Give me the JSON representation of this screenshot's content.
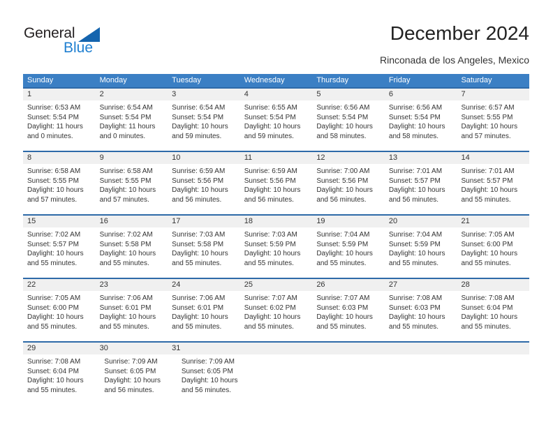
{
  "brand": {
    "name_part1": "General",
    "name_part2": "Blue",
    "triangle_color": "#1464ae",
    "blue_color": "#1f7fd0"
  },
  "header": {
    "title": "December 2024",
    "subtitle": "Rinconada de los Angeles, Mexico"
  },
  "theme": {
    "header_blue": "#3b7fc4",
    "row_rule_blue": "#2e6aa8",
    "daynum_band": "#f0f0f0",
    "text": "#333333"
  },
  "weekdays": [
    "Sunday",
    "Monday",
    "Tuesday",
    "Wednesday",
    "Thursday",
    "Friday",
    "Saturday"
  ],
  "weeks": [
    {
      "days": [
        {
          "num": "1",
          "sunrise": "Sunrise: 6:53 AM",
          "sunset": "Sunset: 5:54 PM",
          "daylight1": "Daylight: 11 hours",
          "daylight2": "and 0 minutes."
        },
        {
          "num": "2",
          "sunrise": "Sunrise: 6:54 AM",
          "sunset": "Sunset: 5:54 PM",
          "daylight1": "Daylight: 11 hours",
          "daylight2": "and 0 minutes."
        },
        {
          "num": "3",
          "sunrise": "Sunrise: 6:54 AM",
          "sunset": "Sunset: 5:54 PM",
          "daylight1": "Daylight: 10 hours",
          "daylight2": "and 59 minutes."
        },
        {
          "num": "4",
          "sunrise": "Sunrise: 6:55 AM",
          "sunset": "Sunset: 5:54 PM",
          "daylight1": "Daylight: 10 hours",
          "daylight2": "and 59 minutes."
        },
        {
          "num": "5",
          "sunrise": "Sunrise: 6:56 AM",
          "sunset": "Sunset: 5:54 PM",
          "daylight1": "Daylight: 10 hours",
          "daylight2": "and 58 minutes."
        },
        {
          "num": "6",
          "sunrise": "Sunrise: 6:56 AM",
          "sunset": "Sunset: 5:54 PM",
          "daylight1": "Daylight: 10 hours",
          "daylight2": "and 58 minutes."
        },
        {
          "num": "7",
          "sunrise": "Sunrise: 6:57 AM",
          "sunset": "Sunset: 5:55 PM",
          "daylight1": "Daylight: 10 hours",
          "daylight2": "and 57 minutes."
        }
      ]
    },
    {
      "days": [
        {
          "num": "8",
          "sunrise": "Sunrise: 6:58 AM",
          "sunset": "Sunset: 5:55 PM",
          "daylight1": "Daylight: 10 hours",
          "daylight2": "and 57 minutes."
        },
        {
          "num": "9",
          "sunrise": "Sunrise: 6:58 AM",
          "sunset": "Sunset: 5:55 PM",
          "daylight1": "Daylight: 10 hours",
          "daylight2": "and 57 minutes."
        },
        {
          "num": "10",
          "sunrise": "Sunrise: 6:59 AM",
          "sunset": "Sunset: 5:56 PM",
          "daylight1": "Daylight: 10 hours",
          "daylight2": "and 56 minutes."
        },
        {
          "num": "11",
          "sunrise": "Sunrise: 6:59 AM",
          "sunset": "Sunset: 5:56 PM",
          "daylight1": "Daylight: 10 hours",
          "daylight2": "and 56 minutes."
        },
        {
          "num": "12",
          "sunrise": "Sunrise: 7:00 AM",
          "sunset": "Sunset: 5:56 PM",
          "daylight1": "Daylight: 10 hours",
          "daylight2": "and 56 minutes."
        },
        {
          "num": "13",
          "sunrise": "Sunrise: 7:01 AM",
          "sunset": "Sunset: 5:57 PM",
          "daylight1": "Daylight: 10 hours",
          "daylight2": "and 56 minutes."
        },
        {
          "num": "14",
          "sunrise": "Sunrise: 7:01 AM",
          "sunset": "Sunset: 5:57 PM",
          "daylight1": "Daylight: 10 hours",
          "daylight2": "and 55 minutes."
        }
      ]
    },
    {
      "days": [
        {
          "num": "15",
          "sunrise": "Sunrise: 7:02 AM",
          "sunset": "Sunset: 5:57 PM",
          "daylight1": "Daylight: 10 hours",
          "daylight2": "and 55 minutes."
        },
        {
          "num": "16",
          "sunrise": "Sunrise: 7:02 AM",
          "sunset": "Sunset: 5:58 PM",
          "daylight1": "Daylight: 10 hours",
          "daylight2": "and 55 minutes."
        },
        {
          "num": "17",
          "sunrise": "Sunrise: 7:03 AM",
          "sunset": "Sunset: 5:58 PM",
          "daylight1": "Daylight: 10 hours",
          "daylight2": "and 55 minutes."
        },
        {
          "num": "18",
          "sunrise": "Sunrise: 7:03 AM",
          "sunset": "Sunset: 5:59 PM",
          "daylight1": "Daylight: 10 hours",
          "daylight2": "and 55 minutes."
        },
        {
          "num": "19",
          "sunrise": "Sunrise: 7:04 AM",
          "sunset": "Sunset: 5:59 PM",
          "daylight1": "Daylight: 10 hours",
          "daylight2": "and 55 minutes."
        },
        {
          "num": "20",
          "sunrise": "Sunrise: 7:04 AM",
          "sunset": "Sunset: 5:59 PM",
          "daylight1": "Daylight: 10 hours",
          "daylight2": "and 55 minutes."
        },
        {
          "num": "21",
          "sunrise": "Sunrise: 7:05 AM",
          "sunset": "Sunset: 6:00 PM",
          "daylight1": "Daylight: 10 hours",
          "daylight2": "and 55 minutes."
        }
      ]
    },
    {
      "days": [
        {
          "num": "22",
          "sunrise": "Sunrise: 7:05 AM",
          "sunset": "Sunset: 6:00 PM",
          "daylight1": "Daylight: 10 hours",
          "daylight2": "and 55 minutes."
        },
        {
          "num": "23",
          "sunrise": "Sunrise: 7:06 AM",
          "sunset": "Sunset: 6:01 PM",
          "daylight1": "Daylight: 10 hours",
          "daylight2": "and 55 minutes."
        },
        {
          "num": "24",
          "sunrise": "Sunrise: 7:06 AM",
          "sunset": "Sunset: 6:01 PM",
          "daylight1": "Daylight: 10 hours",
          "daylight2": "and 55 minutes."
        },
        {
          "num": "25",
          "sunrise": "Sunrise: 7:07 AM",
          "sunset": "Sunset: 6:02 PM",
          "daylight1": "Daylight: 10 hours",
          "daylight2": "and 55 minutes."
        },
        {
          "num": "26",
          "sunrise": "Sunrise: 7:07 AM",
          "sunset": "Sunset: 6:03 PM",
          "daylight1": "Daylight: 10 hours",
          "daylight2": "and 55 minutes."
        },
        {
          "num": "27",
          "sunrise": "Sunrise: 7:08 AM",
          "sunset": "Sunset: 6:03 PM",
          "daylight1": "Daylight: 10 hours",
          "daylight2": "and 55 minutes."
        },
        {
          "num": "28",
          "sunrise": "Sunrise: 7:08 AM",
          "sunset": "Sunset: 6:04 PM",
          "daylight1": "Daylight: 10 hours",
          "daylight2": "and 55 minutes."
        }
      ]
    },
    {
      "days": [
        {
          "num": "29",
          "sunrise": "Sunrise: 7:08 AM",
          "sunset": "Sunset: 6:04 PM",
          "daylight1": "Daylight: 10 hours",
          "daylight2": "and 55 minutes."
        },
        {
          "num": "30",
          "sunrise": "Sunrise: 7:09 AM",
          "sunset": "Sunset: 6:05 PM",
          "daylight1": "Daylight: 10 hours",
          "daylight2": "and 56 minutes."
        },
        {
          "num": "31",
          "sunrise": "Sunrise: 7:09 AM",
          "sunset": "Sunset: 6:05 PM",
          "daylight1": "Daylight: 10 hours",
          "daylight2": "and 56 minutes."
        },
        {
          "num": "",
          "sunrise": "",
          "sunset": "",
          "daylight1": "",
          "daylight2": ""
        },
        {
          "num": "",
          "sunrise": "",
          "sunset": "",
          "daylight1": "",
          "daylight2": ""
        },
        {
          "num": "",
          "sunrise": "",
          "sunset": "",
          "daylight1": "",
          "daylight2": ""
        },
        {
          "num": "",
          "sunrise": "",
          "sunset": "",
          "daylight1": "",
          "daylight2": ""
        }
      ]
    }
  ]
}
